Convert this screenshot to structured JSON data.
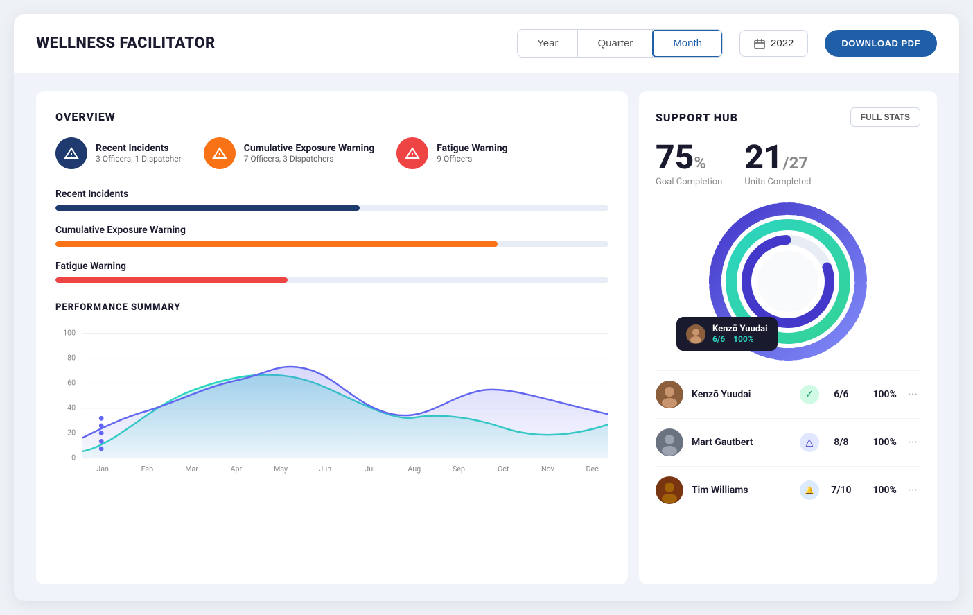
{
  "header": {
    "title": "WELLNESS FACILITATOR",
    "period_buttons": [
      "Year",
      "Quarter",
      "Month"
    ],
    "active_period": "Month",
    "year": "2022",
    "download_label": "DOWNLOAD PDF"
  },
  "overview": {
    "section_title": "OVERVIEW",
    "alerts": [
      {
        "id": "recent-incidents",
        "label": "Recent Incidents",
        "sub": "3 Officers, 1 Dispatcher",
        "color": "dark-blue"
      },
      {
        "id": "cumulative-exposure",
        "label": "Cumulative Exposure Warning",
        "sub": "7 Officers, 3 Dispatchers",
        "color": "orange"
      },
      {
        "id": "fatigue-warning",
        "label": "Fatigue Warning",
        "sub": "9 Officers",
        "color": "red"
      }
    ],
    "progress_bars": [
      {
        "label": "Recent Incidents",
        "value": 55,
        "color": "#1e3a6e"
      },
      {
        "label": "Cumulative Exposure Warning",
        "value": 80,
        "color": "#f97316"
      },
      {
        "label": "Fatigue Warning",
        "value": 42,
        "color": "#ef4444"
      }
    ]
  },
  "performance": {
    "title": "PERFORMANCE SUMMARY",
    "y_labels": [
      "0",
      "20",
      "40",
      "60",
      "80",
      "100"
    ],
    "x_labels": [
      "Jan",
      "Feb",
      "Mar",
      "Apr",
      "May",
      "Jun",
      "Jul",
      "Aug",
      "Sep",
      "Oct",
      "Nov",
      "Dec"
    ]
  },
  "support_hub": {
    "title": "SUPPORT HUB",
    "full_stats_label": "FULL STATS",
    "goal_completion_pct": "75",
    "goal_completion_label": "Goal Completion",
    "units_completed": "21",
    "units_total": "27",
    "units_label": "Units Completed",
    "tooltip": {
      "name": "Kenzō Yuudai",
      "score": "6/6",
      "pct": "100%"
    },
    "people": [
      {
        "name": "Kenzō Yuudai",
        "badge_type": "green",
        "badge_icon": "✓",
        "score": "6/6",
        "pct": "100%"
      },
      {
        "name": "Mart Gautbert",
        "badge_type": "indigo",
        "badge_icon": "△",
        "score": "8/8",
        "pct": "100%"
      },
      {
        "name": "Tim Williams",
        "badge_type": "blue",
        "badge_icon": "🔔",
        "score": "7/10",
        "pct": "100%"
      }
    ]
  }
}
